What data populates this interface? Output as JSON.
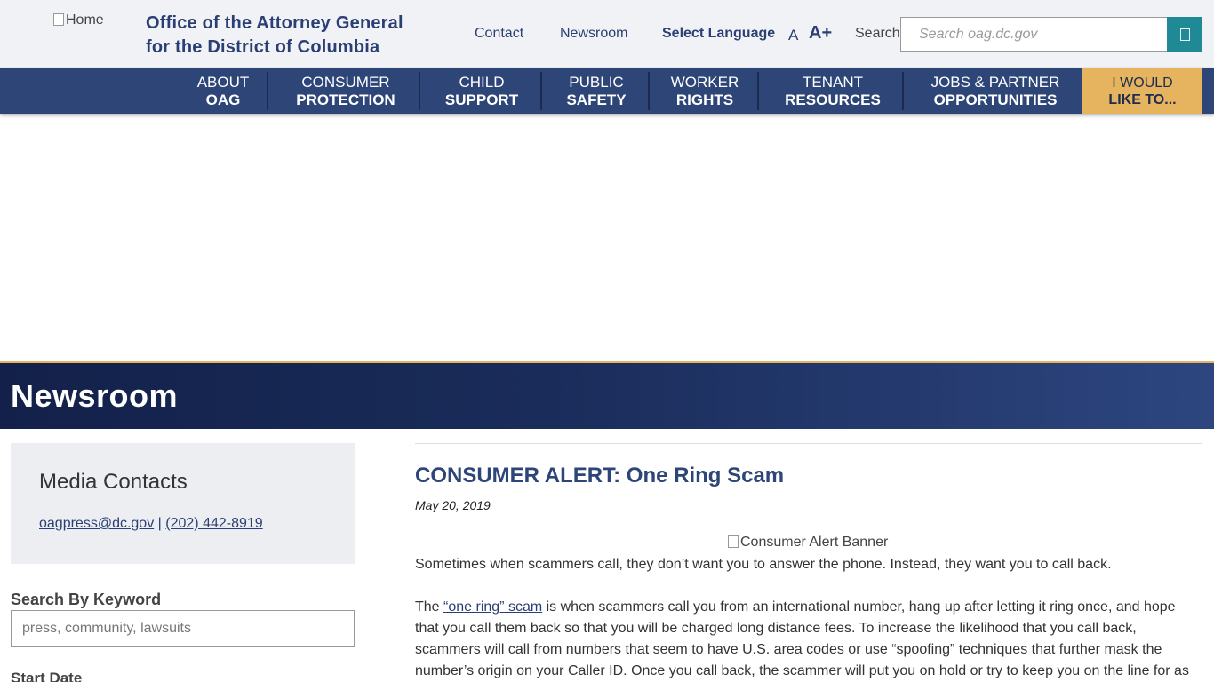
{
  "header": {
    "logo_alt": "Home",
    "title_line1": "Office of the Attorney General",
    "title_line2": "for the District of Columbia",
    "links": {
      "contact": "Contact",
      "newsroom": "Newsroom",
      "language": "Select Language"
    },
    "font_small": "A",
    "font_large": "A+",
    "search_label": "Search",
    "search_placeholder": "Search oag.dc.gov",
    "search_icon": "search-icon"
  },
  "nav": {
    "items": [
      {
        "line1": "ABOUT",
        "line2": "OAG"
      },
      {
        "line1": "CONSUMER",
        "line2": "PROTECTION"
      },
      {
        "line1": "CHILD",
        "line2": "SUPPORT"
      },
      {
        "line1": "PUBLIC",
        "line2": "SAFETY"
      },
      {
        "line1": "WORKER",
        "line2": "RIGHTS"
      },
      {
        "line1": "TENANT",
        "line2": "RESOURCES"
      },
      {
        "line1": "JOBS & PARTNER",
        "line2": "OPPORTUNITIES"
      }
    ],
    "cta": {
      "line1": "I WOULD",
      "line2": "LIKE TO..."
    }
  },
  "hero": {
    "title": "Newsroom"
  },
  "sidebar": {
    "media_title": "Media Contacts",
    "email": "oagpress@dc.gov",
    "separator": "|",
    "phone": "(202) 442-8919",
    "keyword_label": "Search By Keyword",
    "keyword_placeholder": "press, community, lawsuits",
    "start_date_label": "Start Date"
  },
  "article": {
    "title": "CONSUMER ALERT: One Ring Scam",
    "date": "May 20, 2019",
    "banner_alt": "Consumer Alert Banner",
    "para1": "Sometimes when scammers call, they don’t want you to answer the phone. Instead, they want you to call back.",
    "para2_prefix": "The ",
    "para2_link": "“one ring” scam",
    "para2_rest": " is when scammers call you from an international number, hang up after letting it ring once, and hope that you call them back so that you will be charged long distance fees. To increase the likelihood that you call back, scammers will call from numbers that seem to have U.S. area codes or use “spoofing” techniques that further mask the number’s origin on your Caller ID. Once you call back, the scammer will put you on hold or try to keep you on the line for as"
  },
  "colors": {
    "brand_navy": "#2e4577",
    "accent_gold": "#e6b35e",
    "search_teal": "#1f8a96"
  }
}
